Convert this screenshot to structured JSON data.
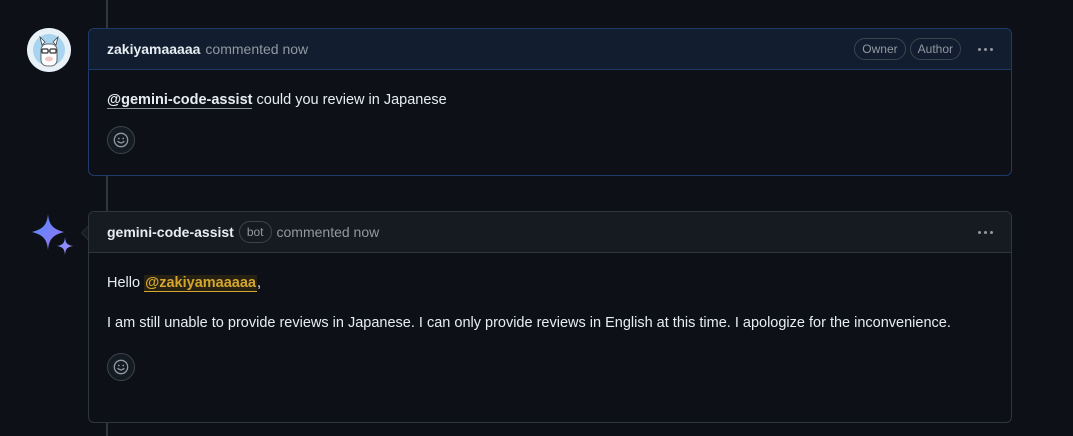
{
  "comments": [
    {
      "author": "zakiyamaaaaa",
      "action": "commented now",
      "badges": [
        "Owner",
        "Author"
      ],
      "body": {
        "mention": "@gemini-code-assist",
        "text": " could you review in Japanese"
      }
    },
    {
      "author": "gemini-code-assist",
      "bot_label": "bot",
      "action": "commented now",
      "body": {
        "greeting": "Hello ",
        "mention": "@zakiyamaaaaa",
        "greeting_end": ",",
        "paragraph": "I am still unable to provide reviews in Japanese. I can only provide reviews in English at this time. I apologize for the inconvenience."
      }
    }
  ],
  "icons": {
    "more": "kebab-horizontal-icon",
    "reaction": "smiley-icon",
    "bot_avatar": "gemini-sparkle-icon"
  },
  "colors": {
    "background": "#0d1117",
    "mention_highlight": "#d4a72c",
    "owner_header": "#121d2f"
  }
}
